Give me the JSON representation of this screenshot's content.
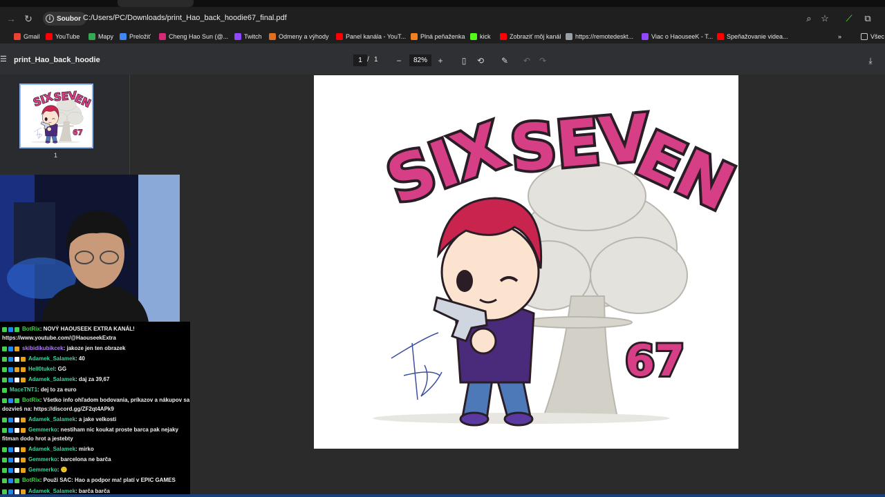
{
  "browser": {
    "chip_label": "Soubor",
    "url": "C:/Users/PC/Downloads/print_Hao_back_hoodie67_final.pdf",
    "icons": [
      "forward-icon",
      "reload-icon",
      "info-icon",
      "zoom-icon",
      "star-icon",
      "extension-icon",
      "puzzle-icon"
    ],
    "bookmarks": [
      {
        "label": "Gmail",
        "color": "#ea4335"
      },
      {
        "label": "YouTube",
        "color": "#ff0000"
      },
      {
        "label": "Mapy",
        "color": "#34a853"
      },
      {
        "label": "Preložiť",
        "color": "#4285f4"
      },
      {
        "label": "Cheng Hao Sun (@...",
        "color": "#d62976"
      },
      {
        "label": "Twitch",
        "color": "#9146ff"
      },
      {
        "label": "Odmeny a výhody",
        "color": "#e07020"
      },
      {
        "label": "Panel kanála - YouT...",
        "color": "#ff0000"
      },
      {
        "label": "Plná peňaženka",
        "color": "#f08020"
      },
      {
        "label": "kick",
        "color": "#53fc18"
      },
      {
        "label": "Zobraziť môj kanál",
        "color": "#ff0000"
      },
      {
        "label": "https://remotedeskt...",
        "color": "#9aa0a6"
      },
      {
        "label": "Viac o HaouseeK - T...",
        "color": "#9146ff"
      },
      {
        "label": "Speňažovanie videa...",
        "color": "#ff0000"
      }
    ],
    "bookmarks_more": "»",
    "bookmarks_folder": "Všec"
  },
  "pdf": {
    "title": "print_Hao_back_hoodie",
    "page_current": "1",
    "page_sep": "/",
    "page_total": "1",
    "zoom": "82%",
    "thumb_label": "1"
  },
  "artwork": {
    "title": "SIX SEVEN",
    "number": "67",
    "colors": {
      "pink": "#d63f85",
      "dark": "#2a1d26",
      "purple": "#4a2a7a",
      "jeans": "#4d79b8",
      "hair": "#c8244e"
    }
  },
  "chat": [
    {
      "user": "BotRix",
      "color": "#3fd34a",
      "text": ": NOVÝ HAOUSEEK EXTRA KANÁL!",
      "badges": [
        "#3fd34a",
        "#1e88e5",
        "#3fd34a"
      ]
    },
    {
      "user": "",
      "color": "#f0f0f0",
      "text": "https://www.youtube.com/@HaouseekExtra",
      "badges": []
    },
    {
      "user": "skibidikubikcek",
      "color": "#b37bff",
      "text": ": jakoze jen ten obrazek",
      "badges": [
        "#3fd34a",
        "#1e88e5",
        "#e6a21a"
      ]
    },
    {
      "user": "Adamek_Salamek",
      "color": "#3fd3a0",
      "text": ": 40",
      "badges": [
        "#3fd34a",
        "#1e88e5",
        "#ffffff",
        "#e6a21a"
      ]
    },
    {
      "user": "Hell0tukel",
      "color": "#3fd3a0",
      "text": ": GG",
      "badges": [
        "#3fd34a",
        "#1e88e5",
        "#e6a21a",
        "#e6a21a"
      ]
    },
    {
      "user": "Adamek_Salamek",
      "color": "#3fd3a0",
      "text": ": daj za 39,67",
      "badges": [
        "#3fd34a",
        "#1e88e5",
        "#ffffff",
        "#e6a21a"
      ]
    },
    {
      "user": "MaceTNT1",
      "color": "#3fd3a0",
      "text": ": dej to za euro",
      "badges": [
        "#3fd34a"
      ]
    },
    {
      "user": "BotRix",
      "color": "#3fd34a",
      "text": ": Všetko info ohľadom bodovania, príkazov a nákupov sa",
      "badges": [
        "#3fd34a",
        "#1e88e5",
        "#3fd34a"
      ]
    },
    {
      "user": "",
      "color": "#f0f0f0",
      "text": "dozvieš na: https://discord.gg/ZF2qt4APk9",
      "badges": []
    },
    {
      "user": "Adamek_Salamek",
      "color": "#3fd3a0",
      "text": ": a jake velkosti",
      "badges": [
        "#3fd34a",
        "#1e88e5",
        "#ffffff",
        "#e6a21a"
      ]
    },
    {
      "user": "Gemmerko",
      "color": "#3fd3a0",
      "text": ": nestiham nic koukat proste barca pak nejaky",
      "badges": [
        "#3fd34a",
        "#1e88e5",
        "#ffffff",
        "#e6a21a"
      ]
    },
    {
      "user": "",
      "color": "#f0f0f0",
      "text": "fitman dodo hrot a jestebty",
      "badges": []
    },
    {
      "user": "Adamek_Salamek",
      "color": "#3fd3a0",
      "text": ": mirko",
      "badges": [
        "#3fd34a",
        "#1e88e5",
        "#ffffff",
        "#e6a21a"
      ]
    },
    {
      "user": "Gemmerko",
      "color": "#3fd3a0",
      "text": ": barcelona ne barča",
      "badges": [
        "#3fd34a",
        "#1e88e5",
        "#ffffff",
        "#e6a21a"
      ]
    },
    {
      "user": "Gemmerko",
      "color": "#3fd3a0",
      "text": ": 🙂",
      "badges": [
        "#3fd34a",
        "#1e88e5",
        "#ffffff",
        "#e6a21a"
      ]
    },
    {
      "user": "BotRix",
      "color": "#3fd34a",
      "text": ": Použi SAC: Hao a podpor ma! platí v EPIC GAMES",
      "badges": [
        "#3fd34a",
        "#1e88e5",
        "#3fd34a"
      ]
    },
    {
      "user": "Adamek_Salamek",
      "color": "#3fd3a0",
      "text": ": barča barča",
      "badges": [
        "#3fd34a",
        "#1e88e5",
        "#ffffff",
        "#e6a21a"
      ]
    }
  ]
}
